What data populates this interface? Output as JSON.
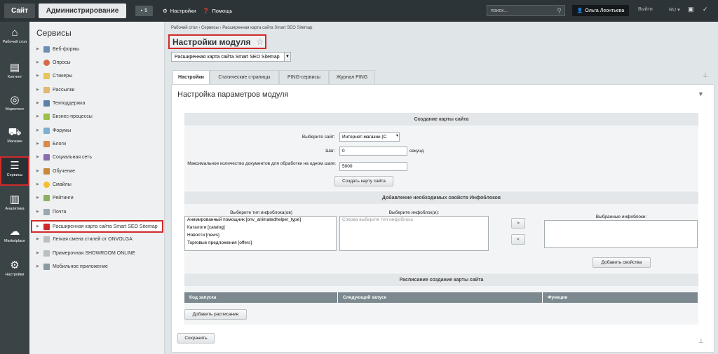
{
  "topbar": {
    "site": "Сайт",
    "admin": "Администрирование",
    "notif_count": "5",
    "settings": "Настройки",
    "help": "Помощь",
    "search_placeholder": "поиск...",
    "user": "Ольга Леонтьева",
    "logout": "Выйти",
    "lang": "RU"
  },
  "leftnav": [
    {
      "label": "Рабочий стол",
      "icon": "home-icon"
    },
    {
      "label": "Контент",
      "icon": "document-icon"
    },
    {
      "label": "Маркетинг",
      "icon": "target-icon"
    },
    {
      "label": "Магазин",
      "icon": "cart-icon"
    },
    {
      "label": "Сервисы",
      "icon": "layers-icon"
    },
    {
      "label": "Аналитика",
      "icon": "bar-chart-icon"
    },
    {
      "label": "Marketplace",
      "icon": "cloud-icon"
    },
    {
      "label": "Настройки",
      "icon": "gear-icon"
    }
  ],
  "sidebar": {
    "title": "Сервисы",
    "items": [
      "Веб-формы",
      "Опросы",
      "Стикеры",
      "Рассылки",
      "Техподдержка",
      "Бизнес-процессы",
      "Форумы",
      "Блоги",
      "Социальная сеть",
      "Обучение",
      "Смайлы",
      "Рейтинги",
      "Почта",
      "Расширенная карта сайта Smart SEO Sitemap",
      "Легкая смена стилей от ONVOLGA",
      "Примерочная SHOWROOM ONLINE",
      "Мобильное приложение"
    ]
  },
  "breadcrumb": {
    "a": "Рабочий стол",
    "b": "Сервисы",
    "c": "Расширенная карта сайта Smart SEO Sitemap",
    "sep": "›"
  },
  "page": {
    "title": "Настройки модуля",
    "module_select": "Расширенная карта сайта Smart SEO Sitemap"
  },
  "tabs": [
    "Настройки",
    "Статические страницы",
    "PING-сервисы",
    "Журнал PING"
  ],
  "section": {
    "title": "Настройка параметров модуля"
  },
  "sitemap": {
    "header": "Создание карты сайта",
    "site_label": "Выберите сайт:",
    "site_value": "Интернет-магазин (С",
    "step_label": "Шаг:",
    "step_value": "0",
    "step_unit": "секунд",
    "max_label": "Максимальное количество документов для обработки на одном шаге:",
    "max_value": "5000",
    "create_btn": "Создать карту сайта"
  },
  "iblock": {
    "header": "Добавление необходимых свойств Инфоблоков",
    "type_label": "Выберите тип инфоблока(ов)",
    "types": [
      "Анимированный помощник [onv_animatedhelper_type]",
      "Каталоги [catalog]",
      "Новости [news]",
      "Торговые предложения [offers]"
    ],
    "iblock_label": "Выберите инфоблок(и):",
    "iblock_placeholder": "Сперва выберите тип инфоблока",
    "selected_label": "Выбранные инфоблоки:",
    "add_btn": "Добавить свойства",
    "move_right": ">",
    "move_left": "<"
  },
  "schedule": {
    "header": "Расписание создание карты сайта",
    "columns": [
      "Код запуска",
      "Следующий запуск",
      "Функции"
    ],
    "add_btn": "Добавить расписание"
  },
  "save_btn": "Сохранить"
}
